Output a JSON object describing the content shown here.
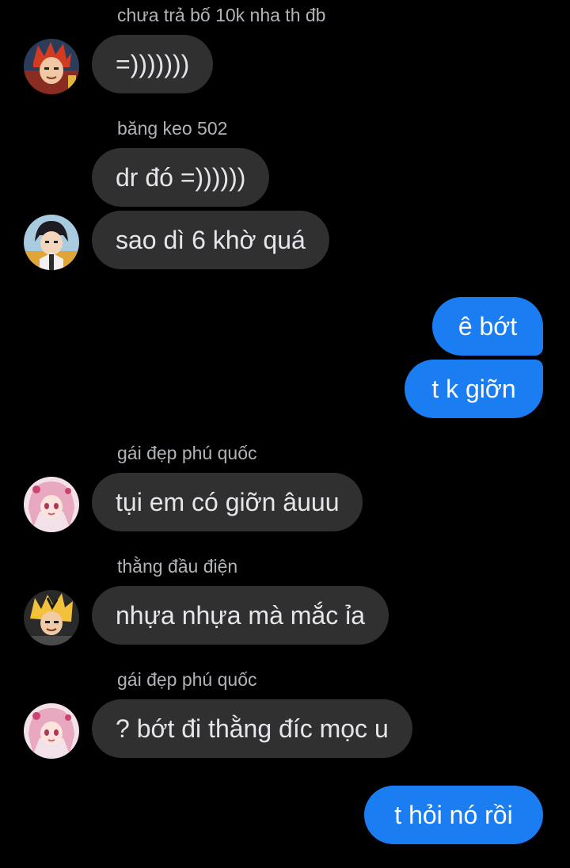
{
  "messages": [
    {
      "type": "sender_name",
      "text": "chưa trả bố 10k nha th đb"
    },
    {
      "type": "incoming",
      "text": "=)))))))"
    },
    {
      "type": "sender_name",
      "text": "băng keo 502"
    },
    {
      "type": "incoming",
      "text": "dr đó =))))))"
    },
    {
      "type": "incoming",
      "text": "sao dì 6 khờ quá"
    },
    {
      "type": "outgoing",
      "text": "ê bớt"
    },
    {
      "type": "outgoing",
      "text": "t k giỡn"
    },
    {
      "type": "sender_name",
      "text": "gái đẹp phú quốc"
    },
    {
      "type": "incoming",
      "text": "tụi em có giỡn âuuu"
    },
    {
      "type": "sender_name",
      "text": "thằng đầu điện"
    },
    {
      "type": "incoming",
      "text": "nhựa nhựa mà mắc ỉa"
    },
    {
      "type": "sender_name",
      "text": "gái đẹp phú quốc"
    },
    {
      "type": "incoming",
      "text": "? bớt đi thằng đíc mọc u"
    },
    {
      "type": "outgoing",
      "text": "t hỏi nó rồi"
    }
  ],
  "colors": {
    "background": "#000000",
    "incoming_bubble": "#303030",
    "outgoing_bubble": "#1a7df2",
    "name_text": "#b0b3b8"
  },
  "avatars": [
    {
      "icon": "red-hair-avatar-icon"
    },
    {
      "icon": "black-hair-avatar-icon"
    },
    {
      "icon": "pink-hair-avatar-icon"
    },
    {
      "icon": "blonde-hair-avatar-icon"
    },
    {
      "icon": "pink-hair-avatar-icon"
    }
  ]
}
